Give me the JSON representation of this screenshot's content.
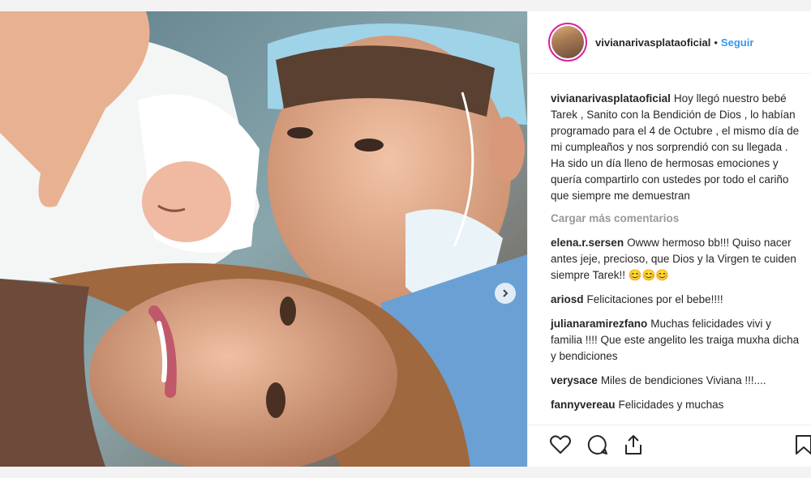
{
  "post": {
    "username": "vivianarivasplataoficial",
    "separator": "•",
    "follow_label": "Seguir"
  },
  "caption": {
    "username": "vivianarivasplataoficial",
    "text": "Hoy llegó nuestro bebé Tarek , Sanito con la Bendición de Dios , lo habían programado para el 4 de Octubre , el mismo día de mi cumpleaños y nos sorprendió con su llegada . Ha sido un día lleno de hermosas emociones y quería compartirlo con ustedes por todo el cariño que siempre me demuestran"
  },
  "load_more_label": "Cargar más comentarios",
  "comments": [
    {
      "username": "elena.r.sersen",
      "text": "Owww hermoso bb!!! Quiso nacer antes jeje, precioso, que Dios y la Virgen te cuiden siempre Tarek!! 😊😊😊"
    },
    {
      "username": "ariosd",
      "text": "Felicitaciones por el bebe!!!!"
    },
    {
      "username": "julianaramirezfano",
      "text": "Muchas felicidades vivi y familia !!!! Que este angelito les traiga muxha dicha y bendiciones"
    },
    {
      "username": "verysace",
      "text": "Miles de bendiciones Viviana !!!...."
    },
    {
      "username": "fannyvereau",
      "text": "Felicidades y muchas"
    }
  ],
  "icons": {
    "like": "heart-icon",
    "comment": "comment-icon",
    "share": "share-icon",
    "save": "bookmark-icon",
    "next": "chevron-right-icon"
  },
  "colors": {
    "link": "#3897f0",
    "text": "#262626",
    "muted": "#999999",
    "avatar_ring": "#d6249f"
  }
}
